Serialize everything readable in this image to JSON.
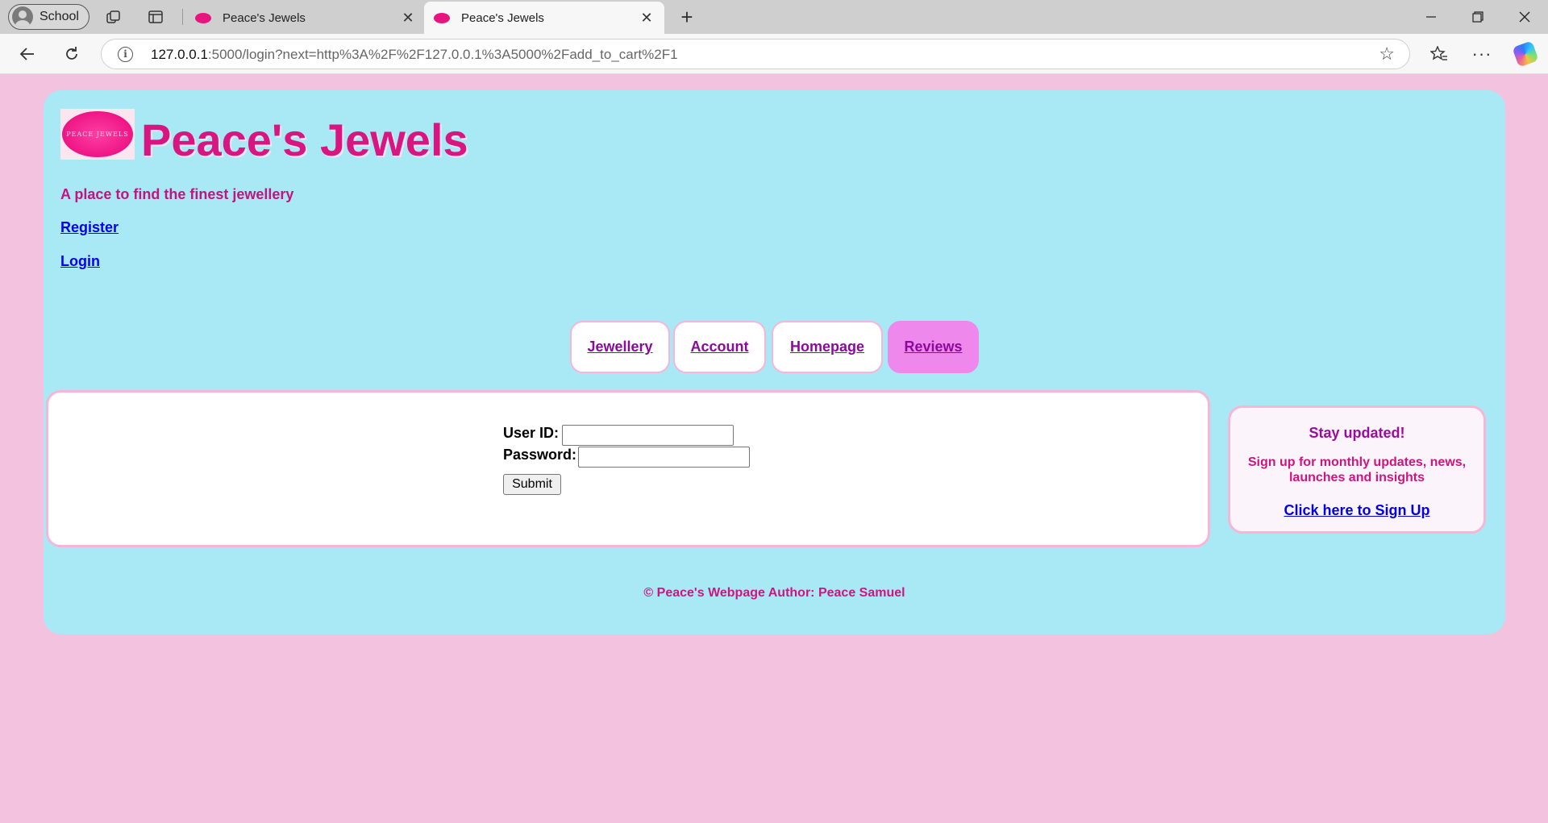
{
  "browser": {
    "profile_label": "School",
    "tabs": [
      {
        "title": "Peace's Jewels",
        "active": false
      },
      {
        "title": "Peace's Jewels",
        "active": true
      }
    ],
    "url_host": "127.0.0.1",
    "url_rest": ":5000/login?next=http%3A%2F%2F127.0.0.1%3A5000%2Fadd_to_cart%2F1"
  },
  "site": {
    "logo_text": "PEACE JEWELS",
    "title": "Peace's Jewels",
    "tagline": "A place to find the finest jewellery",
    "register_link": "Register",
    "login_link": "Login"
  },
  "nav": {
    "items": [
      {
        "label": "Jewellery"
      },
      {
        "label": "Account"
      },
      {
        "label": "Homepage"
      },
      {
        "label": "Reviews"
      }
    ]
  },
  "login_form": {
    "user_id_label": "User ID:",
    "password_label": "Password:",
    "user_id_value": "",
    "password_value": "",
    "submit_label": "Submit"
  },
  "signup": {
    "title": "Stay updated!",
    "text": "Sign up for monthly updates, news, launches and insights",
    "link": "Click here to Sign Up"
  },
  "footer": {
    "text": "© Peace's Webpage Author: Peace Samuel"
  },
  "colors": {
    "page_background": "#f2c2de",
    "container_background": "#a8e9f5",
    "title_color": "#d81682",
    "active_nav": "#ee88ec"
  }
}
